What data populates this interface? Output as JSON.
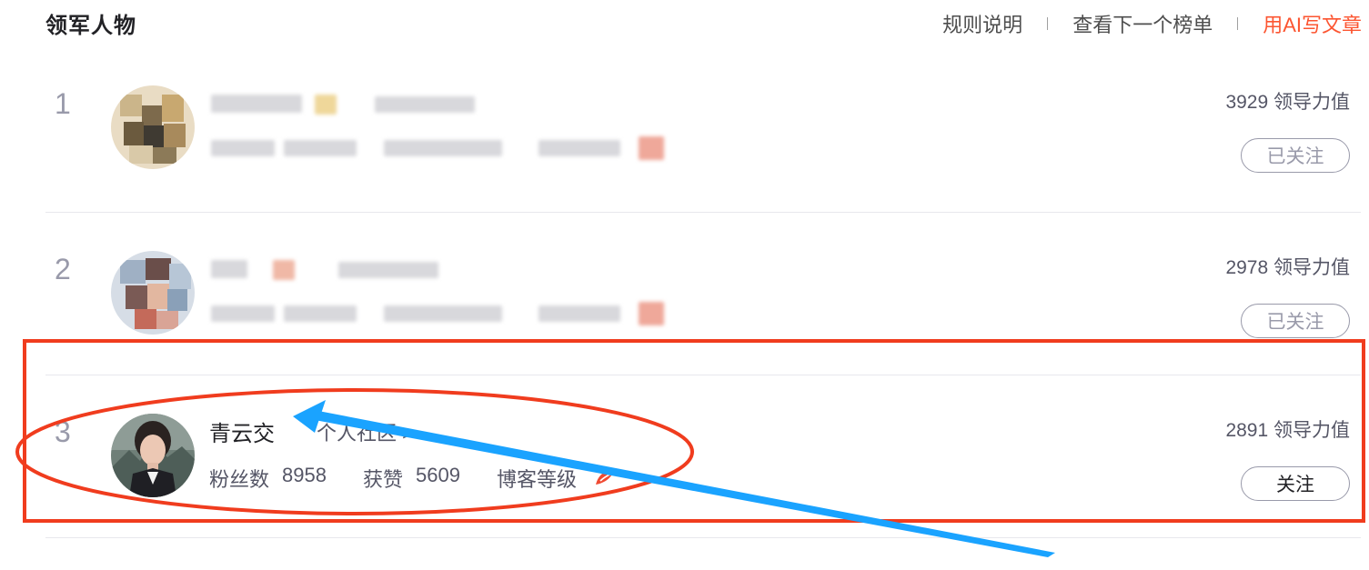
{
  "header": {
    "title": "领军人物",
    "links": [
      "规则说明",
      "查看下一个榜单",
      "用AI写文章"
    ]
  },
  "leaders": [
    {
      "rank": "1",
      "score": "3929 领导力值",
      "follow": "已关注"
    },
    {
      "rank": "2",
      "score": "2978 领导力值",
      "follow": "已关注"
    },
    {
      "rank": "3",
      "name": "青云交",
      "community": "个人社区 >",
      "fans_label": "粉丝数",
      "fans_value": "8958",
      "likes_label": "获赞",
      "likes_value": "5609",
      "level_label": "博客等级",
      "score": "2891 领导力值",
      "follow": "关注"
    }
  ],
  "colors": {
    "accent": "#fc5531",
    "annotation_red": "#f03c1e",
    "annotation_blue": "#1aa3ff"
  },
  "annotations": [
    "highlight-rectangle",
    "highlight-ellipse",
    "pointer-arrow"
  ]
}
